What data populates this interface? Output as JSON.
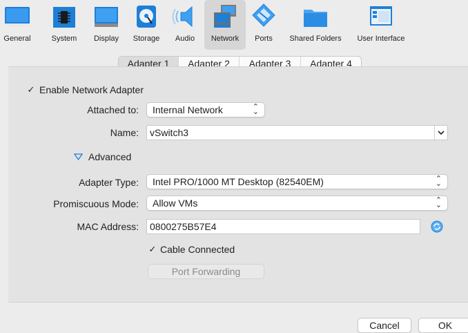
{
  "toolbar": {
    "items": [
      {
        "label": "General",
        "icon": "general-icon"
      },
      {
        "label": "System",
        "icon": "system-chip-icon"
      },
      {
        "label": "Display",
        "icon": "display-monitor-icon"
      },
      {
        "label": "Storage",
        "icon": "storage-disk-icon"
      },
      {
        "label": "Audio",
        "icon": "audio-speaker-icon"
      },
      {
        "label": "Network",
        "icon": "network-icon",
        "selected": true
      },
      {
        "label": "Ports",
        "icon": "ports-icon"
      },
      {
        "label": "Shared Folders",
        "icon": "shared-folder-icon"
      },
      {
        "label": "User Interface",
        "icon": "user-interface-icon"
      }
    ]
  },
  "tabs": [
    "Adapter 1",
    "Adapter 2",
    "Adapter 3",
    "Adapter 4"
  ],
  "active_tab": "Adapter 1",
  "form": {
    "enable_label": "Enable Network Adapter",
    "enable_checked": true,
    "attached_label": "Attached to:",
    "attached_value": "Internal Network",
    "name_label": "Name:",
    "name_value": "vSwitch3",
    "advanced_label": "Advanced",
    "adapter_type_label": "Adapter Type:",
    "adapter_type_value": "Intel PRO/1000 MT Desktop (82540EM)",
    "promiscuous_label": "Promiscuous Mode:",
    "promiscuous_value": "Allow VMs",
    "mac_label": "MAC Address:",
    "mac_value": "0800275B57E4",
    "cable_label": "Cable Connected",
    "cable_checked": true,
    "port_forwarding_label": "Port Forwarding"
  },
  "buttons": {
    "cancel": "Cancel",
    "ok": "OK"
  },
  "colors": {
    "accent_blue": "#1e7fd6",
    "window_bg": "#ececec",
    "panel_bg": "#e3e3e3"
  }
}
